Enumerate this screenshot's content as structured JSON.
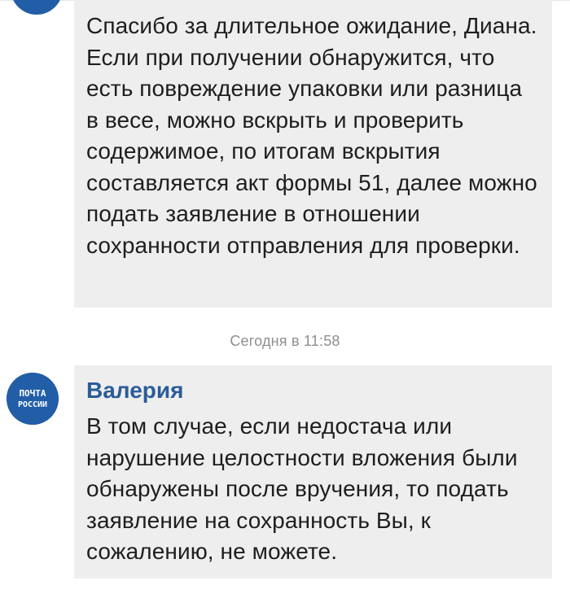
{
  "chat": {
    "messages": [
      {
        "text": "Спасибо за длительное ожидание, Диана. Если при получении обнаружится, что есть повреждение упаковки или разница в весе, можно вскрыть и проверить содержимое, по итогам вскрытия составляется акт формы 51, далее можно подать заявление в отношении сохранности отправления для проверки."
      },
      {
        "sender": "Валерия",
        "text": "В том случае, если недостача или нарушение целостности вложения были обнаружены после вручения, то подать заявление на сохранность Вы, к сожалению, не можете."
      }
    ],
    "timestamp": "Сегодня в 11:58",
    "avatar": {
      "logo_line1": "ПОЧТА",
      "logo_line2": "РОССИИ",
      "color": "#215ea7"
    }
  }
}
